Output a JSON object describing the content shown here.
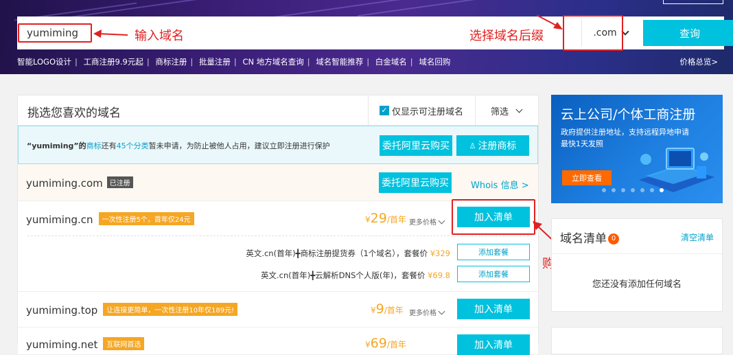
{
  "search": {
    "value": "yumiming",
    "suffix": ".com",
    "query_label": "查询"
  },
  "annotations": {
    "input_domain": "输入域名",
    "choose_suffix": "选择域名后缀",
    "purchase": "购买下单"
  },
  "quicklinks": [
    "智能LOGO设计",
    "工商注册9.9元起",
    "商标注册",
    "批量注册",
    "CN 地方域名查询",
    "域名智能推荐",
    "白金域名",
    "域名回购"
  ],
  "price_overview": "价格总览>",
  "panel": {
    "title": "挑选您喜欢的域名",
    "only_available": "仅显示可注册域名",
    "filter": "筛选"
  },
  "trademark": {
    "text_1": "“yumiming”的",
    "text_link": "商标",
    "text_2": "还有",
    "text_count": "45个分类",
    "text_3": "暂未申请，为防止被他人占用，建议立即注册进行保护",
    "delegate_btn": "委托阿里云购买",
    "register_btn": "注册商标"
  },
  "registered": {
    "domain": "yumiming.com",
    "tag": "已注册",
    "delegate_btn": "委托阿里云购买",
    "whois": "Whois 信息 >"
  },
  "domains": [
    {
      "domain": "yumiming.cn",
      "promo": "一次性注册5个，首年仅24元",
      "price_symbol": "¥",
      "price": "29",
      "price_unit": "/首年",
      "more": "更多价格",
      "add_btn": "加入清单",
      "packages": [
        {
          "text": "英文.cn(首年)╋商标注册提货券（1个域名），套餐价 ",
          "price": "¥329",
          "btn": "添加套餐"
        },
        {
          "text": "英文.cn(首年)╋云解析DNS个人版(年)，套餐价 ",
          "price": "¥69.8",
          "btn": "添加套餐"
        }
      ]
    },
    {
      "domain": "yumiming.top",
      "promo": "让连接更简单，一次性注册10年仅189元!",
      "price_symbol": "¥",
      "price": "9",
      "price_unit": "/首年",
      "more": "更多价格",
      "add_btn": "加入清单"
    },
    {
      "domain": "yumiming.net",
      "promo": "互联网首选",
      "price_symbol": "¥",
      "price": "69",
      "price_unit": "/首年",
      "more": "",
      "add_btn": "加入清单"
    }
  ],
  "banner": {
    "title": "云上公司/个体工商注册",
    "sub_1": "政府提供注册地址，支持远程异地申请",
    "sub_2": "最快1天发照",
    "cta": "立即查看"
  },
  "cart": {
    "title": "域名清单",
    "count": "0",
    "clear": "清空清单",
    "empty": "您还没有添加任何域名"
  },
  "colors": {
    "accent": "#00c1de",
    "annotation": "#e02020",
    "price": "#f5a623",
    "promo": "#f5a623"
  }
}
